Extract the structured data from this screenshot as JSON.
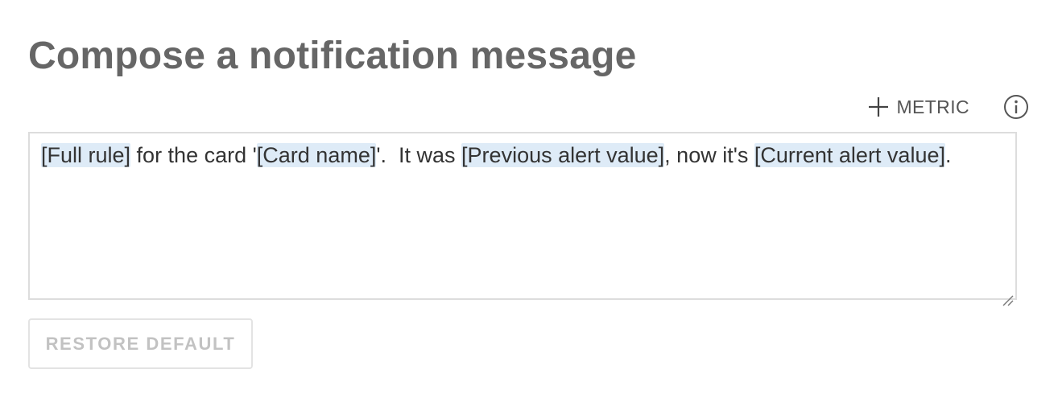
{
  "page": {
    "title": "Compose a notification message"
  },
  "toolbar": {
    "metric_label": "METRIC",
    "metric_icon": "plus-icon",
    "info_icon": "info-icon"
  },
  "editor": {
    "segments": [
      {
        "text": "[Full rule]",
        "token": true
      },
      {
        "text": " for the card '",
        "token": false
      },
      {
        "text": "[Card name]",
        "token": true
      },
      {
        "text": "'.  It was ",
        "token": false
      },
      {
        "text": "[Previous alert value]",
        "token": true
      },
      {
        "text": ", now it's ",
        "token": false
      },
      {
        "text": "[Current alert value]",
        "token": true
      },
      {
        "text": ".",
        "token": false
      }
    ],
    "token_color": "#deebf7"
  },
  "restore": {
    "label": "RESTORE DEFAULT",
    "disabled": true
  }
}
